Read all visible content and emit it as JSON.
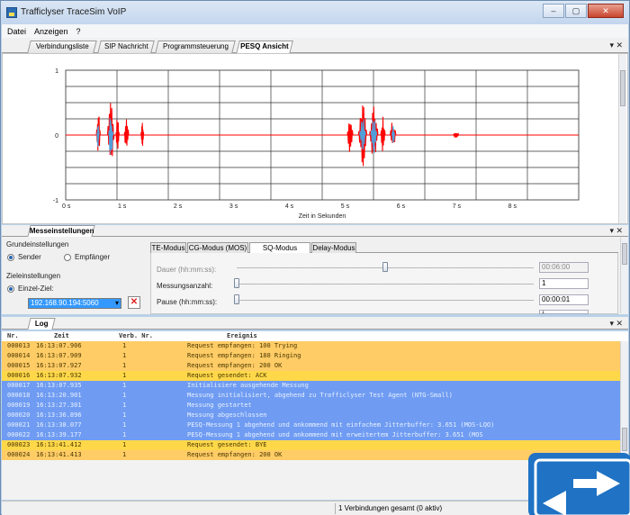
{
  "window": {
    "title": "Trafficlyser TraceSim VoIP",
    "controls": {
      "minimize": "–",
      "maximize": "▢",
      "close": "✕"
    }
  },
  "menu": [
    "Datei",
    "Anzeigen",
    "?"
  ],
  "top_tabs": [
    {
      "label": "Verbindungsliste",
      "active": false
    },
    {
      "label": "SIP Nachricht",
      "active": false
    },
    {
      "label": "Programmsteuerung",
      "active": false
    },
    {
      "label": "PESQ Ansicht",
      "active": true
    }
  ],
  "pane_controls": "▾ ✕",
  "chart_data": {
    "type": "line",
    "xlabel": "Zeit in Sekunden",
    "x_ticks": [
      "0 s",
      "1 s",
      "2 s",
      "3 s",
      "4 s",
      "5 s",
      "6 s",
      "7 s",
      "8 s"
    ],
    "y_ticks": [
      "1",
      "0",
      "-1"
    ],
    "xlim": [
      0,
      9.2
    ],
    "ylim": [
      -1,
      1
    ],
    "series": [
      {
        "color": "#ff0000",
        "bursts": [
          [
            0.55,
            0.62,
            0.38
          ],
          [
            0.75,
            0.87,
            0.62
          ],
          [
            0.9,
            0.96,
            0.3
          ],
          [
            1.05,
            1.13,
            0.28
          ],
          [
            1.35,
            1.4,
            0.22
          ],
          [
            5.05,
            5.15,
            0.28
          ],
          [
            5.25,
            5.4,
            0.5
          ],
          [
            5.45,
            5.6,
            0.45
          ],
          [
            5.65,
            5.73,
            0.3
          ],
          [
            5.82,
            5.92,
            0.26
          ],
          [
            6.95,
            7.05,
            0.06
          ]
        ]
      },
      {
        "color": "#33bbff",
        "bursts": [
          [
            0.56,
            0.6,
            0.28
          ],
          [
            0.77,
            0.85,
            0.4
          ],
          [
            5.27,
            5.38,
            0.33
          ],
          [
            5.47,
            5.58,
            0.3
          ],
          [
            5.85,
            5.9,
            0.16
          ]
        ]
      }
    ],
    "grid": true
  },
  "messe": {
    "tab_label": "Messeinstellungen",
    "grund_label": "Grundeinstellungen",
    "sender_label": "Sender",
    "empfaenger_label": "Empfänger",
    "ziel_label": "Zieleinstellungen",
    "einzel_label": "Einzel-Ziel:",
    "ip_value": "192.168.90.194:5060",
    "inner_tabs": [
      {
        "label": "TE-Modus",
        "active": false
      },
      {
        "label": "CG-Modus (MOS)",
        "active": false
      },
      {
        "label": "SQ-Modus (PESQ)",
        "active": true
      },
      {
        "label": "Delay-Modus",
        "active": false
      }
    ],
    "dauer_label": "Dauer (hh:mm:ss):",
    "dauer_value": "00:06:00",
    "dauer_level": 0.5,
    "anzahl_label": "Messungsanzahl:",
    "anzahl_value": "1",
    "anzahl_level": 0.0,
    "pause_label": "Pause (hh:mm:ss):",
    "pause_value": "00:00:01",
    "pause_level": 0.0,
    "extra_value": "1"
  },
  "log": {
    "tab_label": "Log",
    "headers": {
      "nr": "Nr.",
      "zeit": "Zeit",
      "verb": "Verb. Nr.",
      "ereignis": "Ereignis"
    },
    "rows": [
      {
        "nr": "000013",
        "zeit": "16:13:07.906",
        "verb": "1",
        "ereignis": "Request empfangen: 100 Trying",
        "kind": "sip"
      },
      {
        "nr": "000014",
        "zeit": "16:13:07.909",
        "verb": "1",
        "ereignis": "Request empfangen: 180 Ringing",
        "kind": "sip"
      },
      {
        "nr": "000015",
        "zeit": "16:13:07.927",
        "verb": "1",
        "ereignis": "Request empfangen: 200 OK",
        "kind": "sip"
      },
      {
        "nr": "000016",
        "zeit": "16:13:07.932",
        "verb": "1",
        "ereignis": "Request gesendet:  ACK",
        "kind": "sip-sent"
      },
      {
        "nr": "000017",
        "zeit": "16:13:07.935",
        "verb": "1",
        "ereignis": " Initialisiere ausgehende Messung",
        "kind": "mess"
      },
      {
        "nr": "000018",
        "zeit": "16:13:20.901",
        "verb": "1",
        "ereignis": " Messung initialisiert, abgehend zu Trafficlyser Test Agent (NTG-Small)",
        "kind": "mess"
      },
      {
        "nr": "000019",
        "zeit": "16:13:27.301",
        "verb": "1",
        "ereignis": " Messung gestartet",
        "kind": "mess"
      },
      {
        "nr": "000020",
        "zeit": "16:13:36.896",
        "verb": "1",
        "ereignis": " Messung abgeschlossen",
        "kind": "mess"
      },
      {
        "nr": "000021",
        "zeit": "16:13:38.077",
        "verb": "1",
        "ereignis": " PESQ-Messung 1 abgehend und ankommend mit einfachem Jitterbuffer: 3.651 (MOS-LQO)",
        "kind": "mess"
      },
      {
        "nr": "000022",
        "zeit": "16:13:39.177",
        "verb": "1",
        "ereignis": " PESQ-Messung 1 abgehend und ankommend mit erweitertem Jitterbuffer: 3.651 (MOS",
        "kind": "mess"
      },
      {
        "nr": "000023",
        "zeit": "16:13:41.412",
        "verb": "1",
        "ereignis": "Request gesendet:  BYE",
        "kind": "sip-sent"
      },
      {
        "nr": "000024",
        "zeit": "16:13:41.413",
        "verb": "1",
        "ereignis": "Request empfangen: 200 OK",
        "kind": "sip"
      }
    ]
  },
  "status": {
    "summary": "1 Verbindungen gesamt (0 aktiv)"
  },
  "colors": {
    "sip": "#ffcc66",
    "sip_sent": "#ffd84a",
    "mess": "#6f9cf2",
    "mess_text": "#e8f0ff",
    "sip_text": "#4a3800"
  }
}
